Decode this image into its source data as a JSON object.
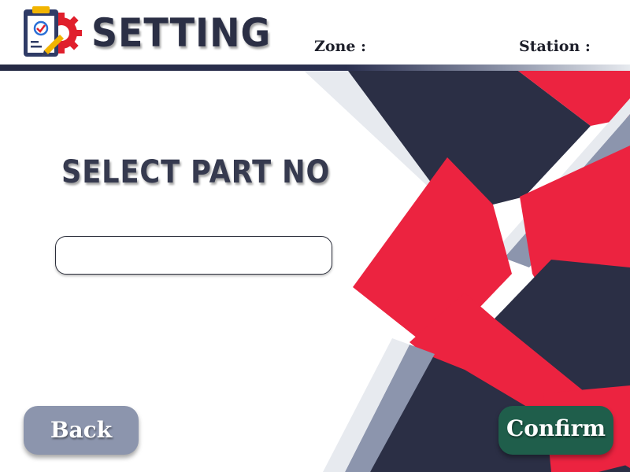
{
  "header": {
    "title": "SETTING",
    "zone_label": "Zone :",
    "station_label": "Station :"
  },
  "main": {
    "prompt": "SELECT PART NO",
    "part_input": {
      "value": "",
      "placeholder": ""
    }
  },
  "buttons": {
    "back_label": "Back",
    "confirm_label": "Confirm"
  },
  "icons": {
    "logo": "settings-checklist-icon"
  },
  "colors": {
    "navy": "#2b2f45",
    "red": "#ec2340",
    "slate": "#8c95ad",
    "confirm_green": "#1f5e4b"
  }
}
